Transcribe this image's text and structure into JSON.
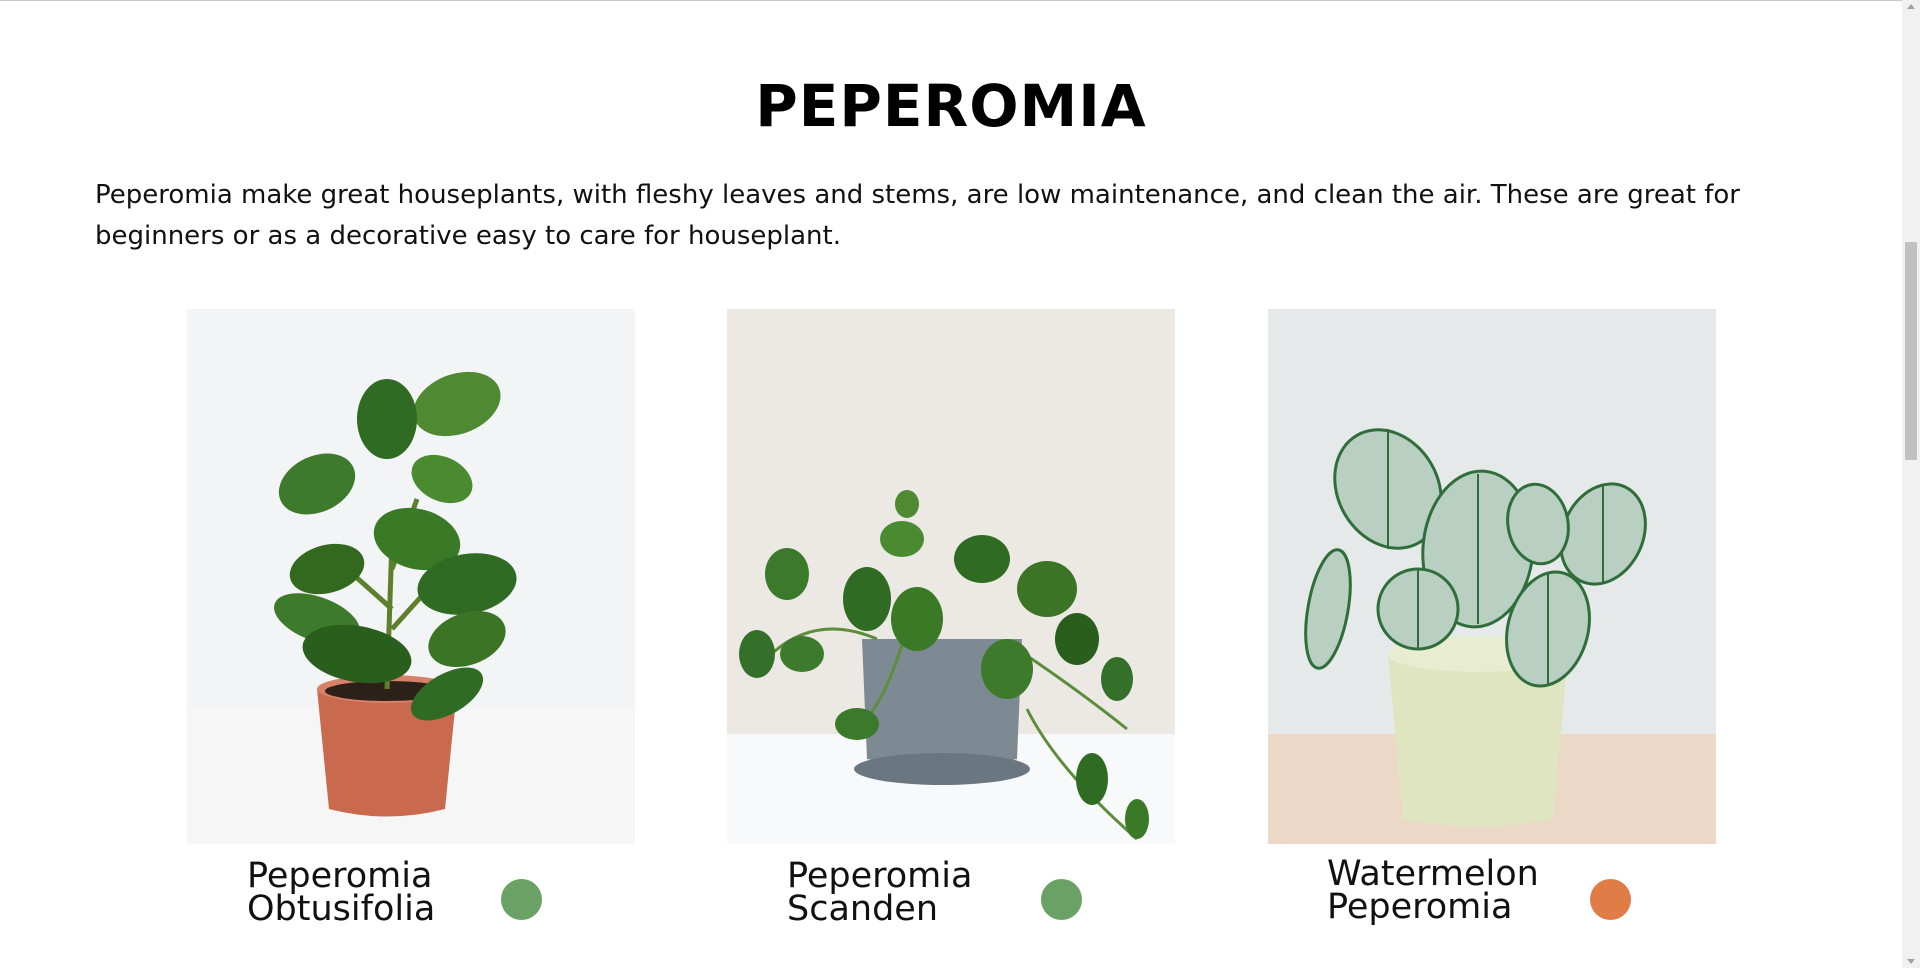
{
  "section": {
    "title": "PEPEROMIA",
    "description": "Peperomia make great houseplants, with fleshy leaves and stems, are low maintenance, and clean the air. These are great for beginners or as a decorative easy to care for houseplant."
  },
  "plants": [
    {
      "name_line1": "Peperomia",
      "name_line2": "Obtusifolia",
      "swatch_color": "#6aa164"
    },
    {
      "name_line1": "Peperomia",
      "name_line2": "Scanden",
      "swatch_color": "#6aa164"
    },
    {
      "name_line1": "Watermelon",
      "name_line2": "Peperomia",
      "swatch_color": "#e07c45"
    }
  ],
  "colors": {
    "leaf_green": "#2f6b22",
    "pot_terracotta": "#c96a4f",
    "pot_grey": "#7d8a93",
    "pot_cream": "#dfe5c0"
  }
}
